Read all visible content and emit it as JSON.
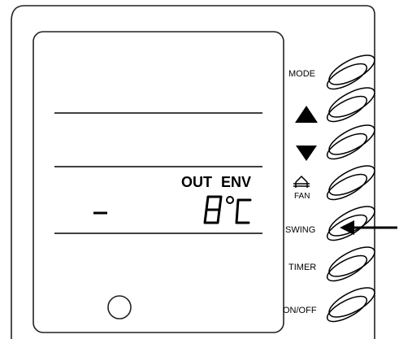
{
  "panel": {
    "display": {
      "heading_out": "OUT",
      "heading_env": "ENV",
      "left_symbol": "–",
      "value": "8",
      "unit": "°C"
    },
    "buttons": {
      "mode_label": "MODE",
      "up_label": "▲",
      "down_label": "▼",
      "fan_label": "FAN",
      "fan_icon": "fan-house-icon",
      "swing_label": "SWING",
      "timer_label": "TIMER",
      "onoff_label": "ON/OFF"
    },
    "pointer_icon": "arrow-left-icon"
  }
}
